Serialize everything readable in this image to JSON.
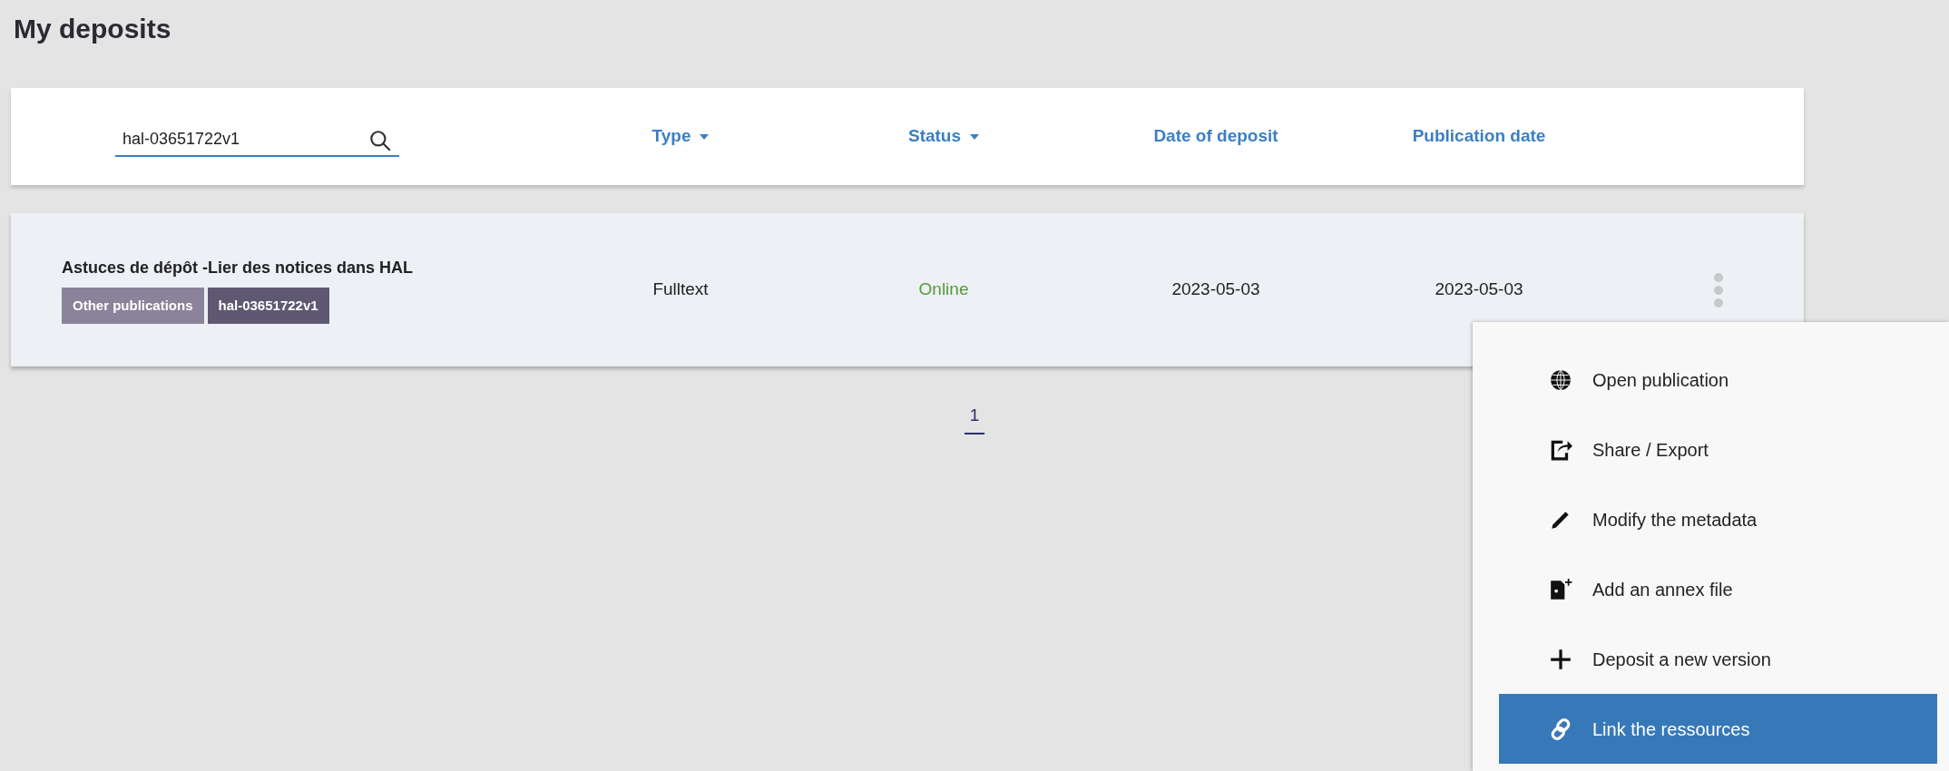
{
  "page_title": "My deposits",
  "search": {
    "value": "hal-03651722v1"
  },
  "columns": [
    {
      "label": "Type",
      "dropdown": true
    },
    {
      "label": "Status",
      "dropdown": true
    },
    {
      "label": "Date of deposit",
      "dropdown": false
    },
    {
      "label": "Publication date",
      "dropdown": false
    }
  ],
  "rows": [
    {
      "title": "Astuces de dépôt -Lier des notices dans HAL",
      "tags": [
        {
          "label": "Other publications",
          "kind": "type"
        },
        {
          "label": "hal-03651722v1",
          "kind": "id"
        }
      ],
      "type": "Fulltext",
      "status": "Online",
      "deposit_date": "2023-05-03",
      "publication_date": "2023-05-03"
    }
  ],
  "pagination": [
    {
      "label": "1",
      "selected": true
    }
  ],
  "menu": [
    {
      "label": "Open publication",
      "kind": "globe",
      "selected": false
    },
    {
      "label": "Share / Export",
      "kind": "share",
      "selected": false
    },
    {
      "label": "Modify the metadata",
      "kind": "pencil",
      "selected": false
    },
    {
      "label": "Add an annex file",
      "kind": "file",
      "selected": false
    },
    {
      "label": "Deposit a new version",
      "kind": "plus",
      "selected": false
    },
    {
      "label": "Link the ressources",
      "kind": "link",
      "selected": true
    }
  ]
}
